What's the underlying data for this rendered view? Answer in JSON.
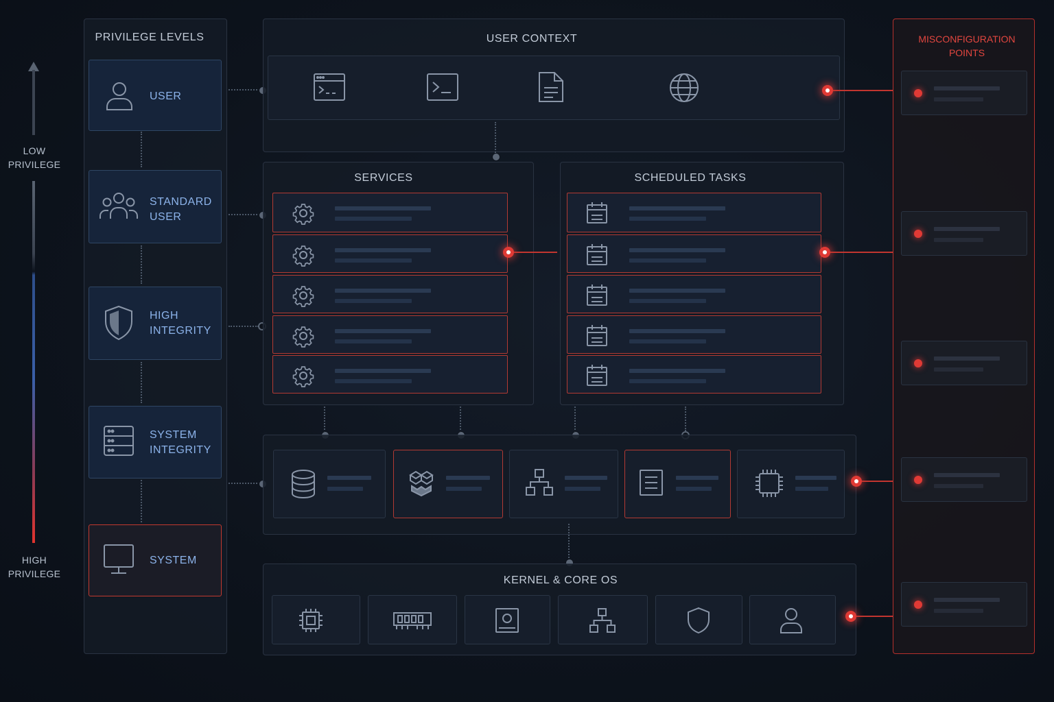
{
  "privilege_axis": {
    "low_label_line1": "LOW",
    "low_label_line2": "PRIVILEGE",
    "high_label_line1": "HIGH",
    "high_label_line2": "PRIVILEGE"
  },
  "privilege_levels": {
    "title": "PRIVILEGE LEVELS",
    "items": [
      {
        "line1": "USER",
        "line2": "",
        "icon": "user-icon"
      },
      {
        "line1": "STANDARD",
        "line2": "USER",
        "icon": "users-group-icon"
      },
      {
        "line1": "HIGH",
        "line2": "INTEGRITY",
        "icon": "shield-icon"
      },
      {
        "line1": "SYSTEM",
        "line2": "INTEGRITY",
        "icon": "server-icon"
      },
      {
        "line1": "SYSTEM",
        "line2": "",
        "icon": "monitor-icon"
      }
    ]
  },
  "user_context": {
    "title": "USER CONTEXT",
    "icons": [
      "app-window-icon",
      "terminal-icon",
      "document-icon",
      "globe-icon"
    ]
  },
  "services": {
    "title": "SERVICES",
    "row_icon": "gear-icon"
  },
  "scheduled_tasks": {
    "title": "SCHEDULED TASKS",
    "row_icon": "calendar-icon"
  },
  "middle_layer": {
    "tiles": [
      "database-icon",
      "package-icon",
      "network-icon",
      "list-document-icon",
      "cpu-chip-icon"
    ]
  },
  "kernel": {
    "title": "KERNEL & CORE OS",
    "tiles": [
      "cpu-chip-icon",
      "memory-icon",
      "disk-icon",
      "network-icon",
      "shield-icon",
      "user-icon"
    ]
  },
  "misconfiguration": {
    "title_line1": "MISCONFIGURATION",
    "title_line2": "POINTS"
  },
  "colors": {
    "accent_red": "#e03a35",
    "accent_blue": "#8cb3ea",
    "background": "#0d131d"
  }
}
